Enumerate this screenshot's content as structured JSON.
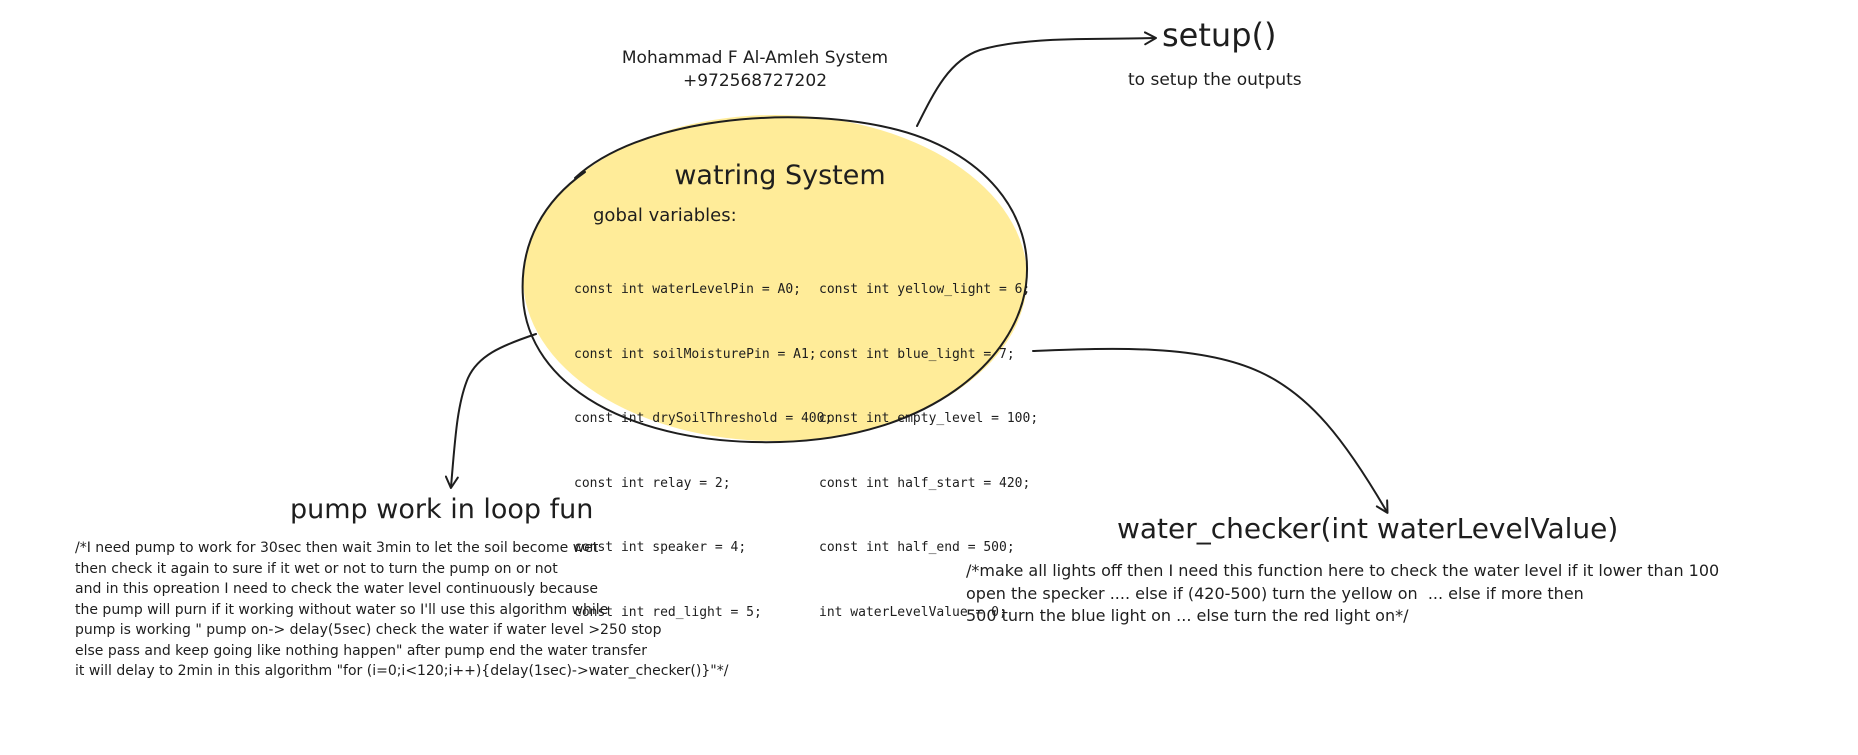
{
  "author": {
    "name": "Mohammad F Al-Amleh System",
    "phone": "+972568727202"
  },
  "main_node": {
    "title": "watring System",
    "globals_label": "gobal variables:",
    "variables_left": [
      "const int waterLevelPin = A0;",
      "const int soilMoisturePin = A1;",
      "const int drySoilThreshold = 400;",
      "const int relay = 2;",
      "const int speaker = 4;",
      "const int red_light = 5;"
    ],
    "variables_right": [
      "const int yellow_light = 6;",
      "const int blue_light = 7;",
      "const int empty_level = 100;",
      "const int half_start = 420;",
      "const int half_end = 500;",
      "int waterLevelValue = 0;"
    ],
    "fill_color": "#ffec99",
    "stroke_color": "#1e1e1e"
  },
  "setup_node": {
    "title": "setup()",
    "description": "to setup the outputs"
  },
  "pump_node": {
    "title": "pump work in loop fun",
    "description": "/*I need pump to work for 30sec then wait 3min to let the soil become wet\nthen check it again to sure if it wet or not to turn the pump on or not\nand in this opreation I need to check the water level continuously because\nthe pump will purn if it working without water so I'll use this algorithm while\npump is working \" pump on-> delay(5sec) check the water if water level >250 stop\nelse pass and keep going like nothing happen\" after pump end the water transfer\nit will delay to 2min in this algorithm \"for (i=0;i<120;i++){delay(1sec)->water_checker()}\"*/"
  },
  "checker_node": {
    "title": "water_checker(int waterLevelValue)",
    "description": "/*make all lights off then I need this function here to check the water level if it lower than 100\nopen the specker .... else if (420-500) turn the yellow on  ... else if more then\n500 turn the blue light on ... else turn the red light on*/"
  }
}
